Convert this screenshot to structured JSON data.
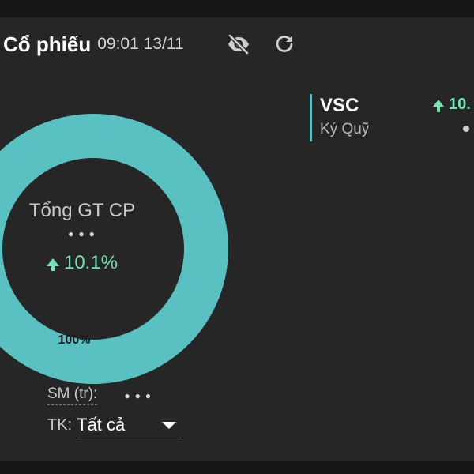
{
  "header": {
    "title": "Cổ phiếu",
    "timestamp": "09:01 13/11"
  },
  "colors": {
    "donut": "#5ac1c3",
    "positive": "#6fe3b1",
    "panel_bg": "#262626"
  },
  "icons": {
    "visibility": "eye-off-icon",
    "refresh": "refresh-icon"
  },
  "summary": {
    "center_label": "Tổng GT CP",
    "center_value": "●●●",
    "change": "10.1%",
    "slice_label": "100%"
  },
  "chart_data": {
    "type": "pie",
    "categories": [
      "VSC"
    ],
    "values": [
      100
    ],
    "unit": "%"
  },
  "legend": {
    "items": [
      {
        "ticker": "VSC",
        "type": "Ký Quỹ",
        "change": "10.",
        "value": "●"
      }
    ]
  },
  "footer": {
    "sm_label": "SM (tr):",
    "sm_value": "●●●",
    "tk_label": "TK:",
    "tk_value": "Tất cả"
  }
}
